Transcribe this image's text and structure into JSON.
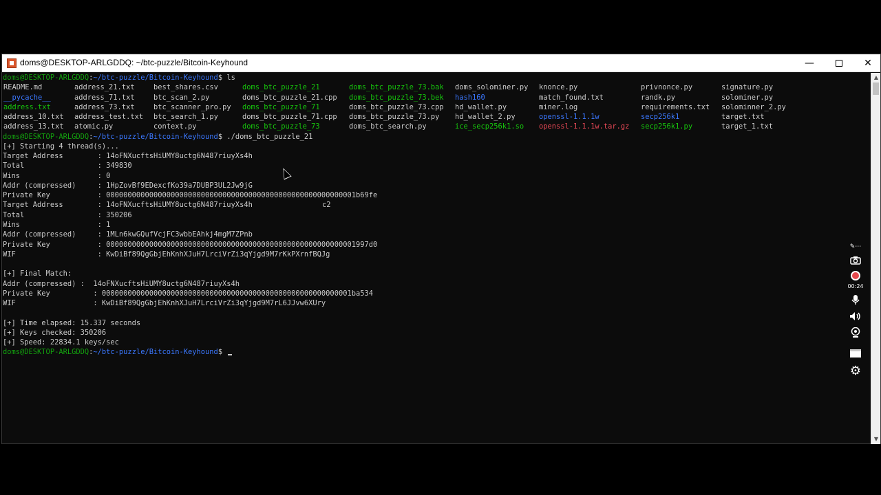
{
  "window": {
    "title": "doms@DESKTOP-ARLGDDQ: ~/btc-puzzle/Bitcoin-Keyhound",
    "minimize_glyph": "—",
    "close_glyph": "✕"
  },
  "prompt": {
    "user_host": "doms@DESKTOP-ARLGDDQ",
    "path": "~/btc-puzzle/Bitcoin-Keyhound",
    "symbol": "$"
  },
  "commands": [
    "ls",
    "./doms_btc_puzzle_21"
  ],
  "ls_columns": [
    [
      "README.md",
      "__pycache__",
      "address.txt",
      "address_10.txt",
      "address_13.txt"
    ],
    [
      "address_21.txt",
      "address_71.txt",
      "address_73.txt",
      "address_test.txt",
      "atomic.py"
    ],
    [
      "best_shares.csv",
      "btc_scan_2.py",
      "btc_scanner_pro.py",
      "btc_search_1.py",
      "context.py"
    ],
    [
      "doms_btc_puzzle_21",
      "doms_btc_puzzle_21.cpp",
      "doms_btc_puzzle_71",
      "doms_btc_puzzle_71.cpp",
      "doms_btc_puzzle_73"
    ],
    [
      "doms_btc_puzzle_73.bak",
      "doms_btc_puzzle_73.bek",
      "doms_btc_puzzle_73.cpp",
      "doms_btc_puzzle_73.py",
      "doms_btc_search.py"
    ],
    [
      "doms_solominer.py",
      "hash160",
      "hd_wallet.py",
      "hd_wallet_2.py",
      "ice_secp256k1.so"
    ],
    [
      "knonce.py",
      "match_found.txt",
      "miner.log",
      "openssl-1.1.1w",
      "openssl-1.1.1w.tar.gz"
    ],
    [
      "privnonce.py",
      "randk.py",
      "requirements.txt",
      "secp256k1",
      "secp256k1.py"
    ],
    [
      "signature.py",
      "solominer.py",
      "solominner_2.py",
      "target.txt",
      "target_1.txt"
    ]
  ],
  "output": {
    "start": "[+] Starting 4 thread(s)...",
    "block1": [
      {
        "label": "Target Address",
        "value": "14oFNXucftsHiUMY8uctg6N487riuyXs4h"
      },
      {
        "label": "Total",
        "value": "349830"
      },
      {
        "label": "Wins",
        "value": "0"
      },
      {
        "label": "Addr (compressed)",
        "value": "1HpZovBf9EDexcfKo39a7DUBP3UL2Jw9jG"
      },
      {
        "label": "Private Key",
        "value": "0000000000000000000000000000000000000000000000000000000001b69fe"
      },
      {
        "label": "Target Address",
        "value": "14oFNXucftsHiUMY8uctg6N487riuyXs4h",
        "extra": "c2"
      },
      {
        "label": "Total",
        "value": "350206"
      },
      {
        "label": "Wins",
        "value": "1"
      },
      {
        "label": "Addr (compressed)",
        "value": "1MLn6kwGQufVcjFC3wbbEAhkj4mgM7ZPnb"
      },
      {
        "label": "Private Key",
        "value": "0000000000000000000000000000000000000000000000000000000001997d0"
      },
      {
        "label": "WIF",
        "value": "KwDiBf89QgGbjEhKnhXJuH7LrciVrZi3qYjgd9M7rKkPXrnfBQJg"
      }
    ],
    "final_header": "[+] Final Match:",
    "final": [
      {
        "label": "Addr (compressed)",
        "value": " 14oFNXucftsHiUMY8uctg6N487riuyXs4h"
      },
      {
        "label": "Private Key",
        "value": "0000000000000000000000000000000000000000000000000000000001ba534"
      },
      {
        "label": "WIF",
        "value": "KwDiBf89QgGbjEhKnhXJuH7LrciVrZi3qYjgd9M7rL6JJvw6XUry"
      }
    ],
    "time_elapsed": "[+] Time elapsed: 15.337 seconds",
    "keys_checked": "[+] Keys checked: 350206",
    "speed": "[+] Speed: 22834.1 keys/sec"
  },
  "recorder": {
    "timer": "00:24"
  },
  "colors": {
    "prompt_user": "#13a10e",
    "prompt_path": "#3b78ff",
    "executable": "#16c60c",
    "directory": "#3b78ff",
    "archive": "#e74856",
    "text": "#cccccc"
  }
}
